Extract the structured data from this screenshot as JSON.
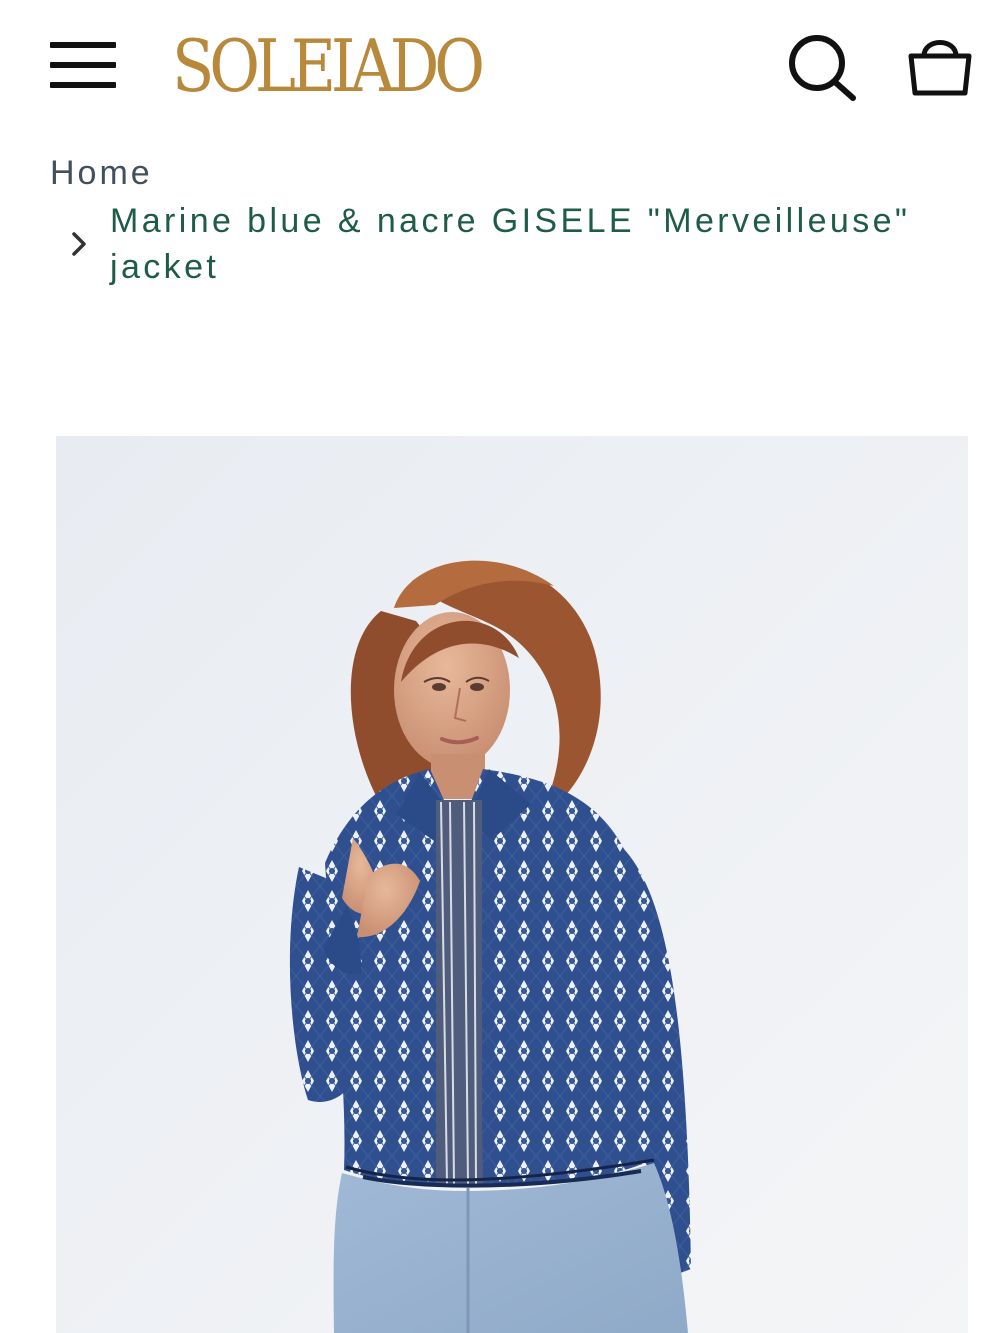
{
  "header": {
    "menu_icon": "hamburger-menu-icon",
    "logo_text": "SOLEIADO",
    "search_icon": "search-icon",
    "cart_icon": "shopping-bag-icon",
    "brand_color": "#b8893a"
  },
  "breadcrumb": {
    "home_label": "Home",
    "separator_icon": "chevron-right-icon",
    "current_label": "Marine blue & nacre GISELE \"Merveilleuse\" jacket",
    "current_color": "#1f5c47"
  },
  "product": {
    "image_subject": "model wearing marine blue quilted jacket with white diamond print"
  }
}
